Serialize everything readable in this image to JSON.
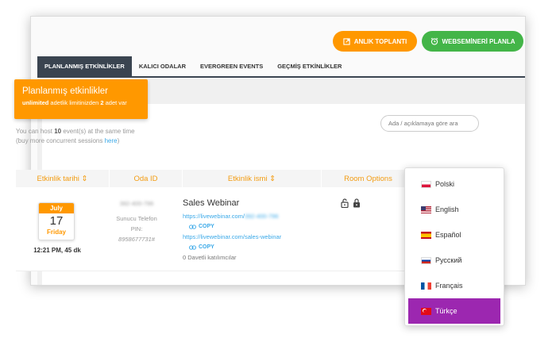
{
  "toolbar": {
    "instant_meeting_label": "ANLIK TOPLANTI",
    "schedule_webinar_label": "WEBSEMİNERİ PLANLA",
    "accent_orange": "#ff9800",
    "accent_green": "#43b548"
  },
  "tabs": [
    {
      "label": "PLANLANMIŞ ETKİNLİKLER",
      "active": true
    },
    {
      "label": "KALICI ODALAR",
      "active": false
    },
    {
      "label": "EVERGREEN EVENTS",
      "active": false
    },
    {
      "label": "GEÇMİŞ ETKİNLİKLER",
      "active": false
    }
  ],
  "card": {
    "title": "Planlanmış etkinlikler",
    "limit_bold": "unlimited",
    "limit_text_1": " adetlik limitinizden ",
    "limit_count": "2",
    "limit_text_2": " adet var"
  },
  "host_info": {
    "line1_a": "You can host ",
    "line1_count": "10",
    "line1_b": " event(s) at the same time",
    "line2_a": "(buy more concurrent sessions ",
    "line2_link": "here",
    "line2_b": ")"
  },
  "search": {
    "placeholder": "Ada / açıklamaya göre ara"
  },
  "table": {
    "headers": [
      "Etkinlik tarihi ⇕",
      "Oda ID",
      "Etkinlik ismi ⇕",
      "Room Options",
      ""
    ],
    "row": {
      "month": "July",
      "day": "17",
      "weekday": "Friday",
      "time": "12:21 PM, 45 dk",
      "room_id": "392-400-796",
      "phone_label": "Sunucu Telefon",
      "pin_label": "PIN:",
      "pin": "8958677731#",
      "event_name": "Sales Webinar",
      "url1_prefix": "https://livewebinar.com/",
      "url1_id": "392-400-796",
      "copy_label": "COPY",
      "url2": "https://livewebinar.com/sales-webinar",
      "invited": "0 Davetli katılımcılar"
    }
  },
  "languages": [
    {
      "label": "Polski",
      "flag": "pl",
      "active": false
    },
    {
      "label": "English",
      "flag": "us",
      "active": false
    },
    {
      "label": "Español",
      "flag": "es",
      "active": false
    },
    {
      "label": "Русский",
      "flag": "ru",
      "active": false
    },
    {
      "label": "Français",
      "flag": "fr",
      "active": false
    },
    {
      "label": "Türkçe",
      "flag": "tr",
      "active": true
    }
  ]
}
